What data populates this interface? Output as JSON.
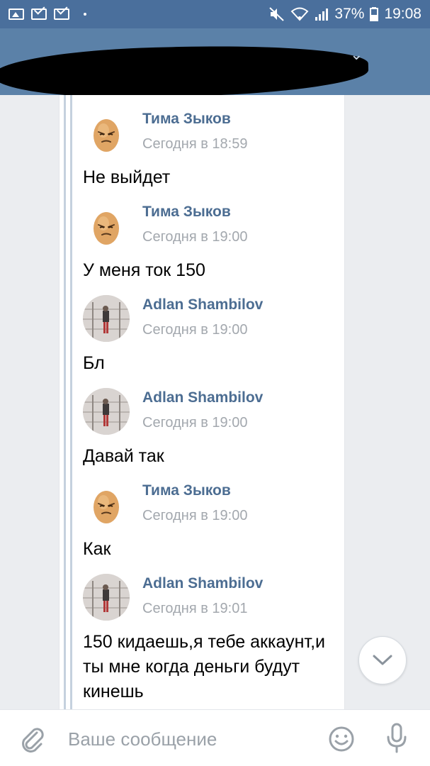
{
  "status_bar": {
    "battery": "37%",
    "time": "19:08"
  },
  "messages": [
    {
      "author": "Тима Зыков",
      "time": "Сегодня в 18:59",
      "text": "Не выйдет",
      "avatar": "egg"
    },
    {
      "author": "Тима Зыков",
      "time": "Сегодня в 19:00",
      "text": "У меня ток 150",
      "avatar": "egg"
    },
    {
      "author": "Adlan Shambilov",
      "time": "Сегодня в 19:00",
      "text": "Бл",
      "avatar": "photo"
    },
    {
      "author": "Adlan Shambilov",
      "time": "Сегодня в 19:00",
      "text": "Давай так",
      "avatar": "photo"
    },
    {
      "author": "Тима Зыков",
      "time": "Сегодня в 19:00",
      "text": "Как",
      "avatar": "egg"
    },
    {
      "author": "Adlan Shambilov",
      "time": "Сегодня в 19:01",
      "text": "150 кидаешь,я тебе аккаунт,и ты мне когда деньги будут кинешь",
      "avatar": "photo"
    }
  ],
  "composer": {
    "placeholder": "Ваше сообщение"
  },
  "icons": {
    "attach": "paperclip-icon",
    "emoji": "smile-icon",
    "mic": "microphone-icon",
    "scroll": "chevron-down-icon"
  },
  "colors": {
    "header": "#5b81a8",
    "status_bar": "#4a6f9c",
    "author_name": "#4c6d92",
    "timestamp": "#a3a8ae"
  }
}
